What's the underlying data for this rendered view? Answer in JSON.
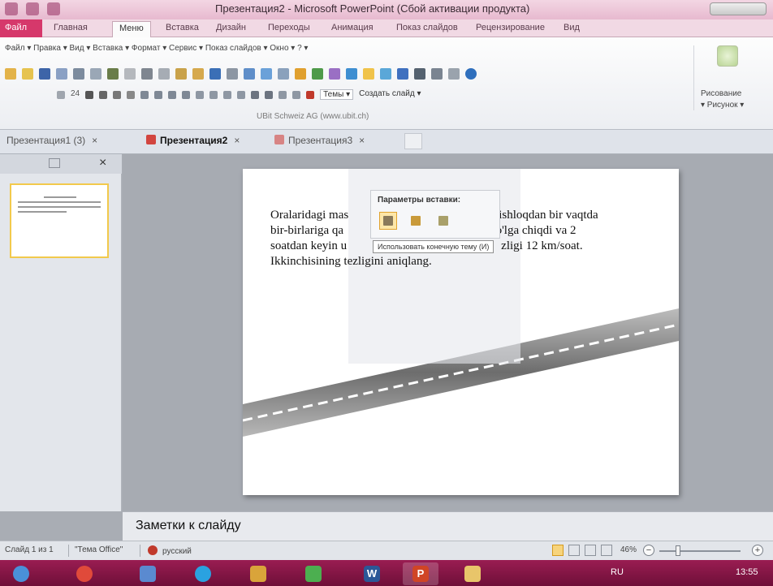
{
  "window": {
    "title": "Презентация2 - Microsoft PowerPoint (Сбой активации продукта)"
  },
  "ribbon_tabs": [
    "Файл",
    "Главная",
    "Меню",
    "Вставка",
    "Дизайн",
    "Переходы",
    "Анимация",
    "Показ слайдов",
    "Рецензирование",
    "Вид"
  ],
  "ribbon": {
    "menu_row": "Файл ▾ Правка ▾ Вид ▾ Вставка ▾ Формат ▾ Сервис ▾ Показ слайдов ▾ Окно ▾ ? ▾",
    "font_size": "24",
    "themes_label": "Темы ▾",
    "create_slide_label": "Создать слайд ▾",
    "credit": "UBit Schweiz AG   (www.ubit.ch)",
    "drawing_label": "Рисование",
    "picture_label": "▾ Рисунок ▾"
  },
  "doc_tabs": [
    {
      "label": "Презентация1 (3)",
      "close": "×"
    },
    {
      "label": "Презентация2",
      "close": "×"
    },
    {
      "label": "Презентация3",
      "close": "×"
    }
  ],
  "slide": {
    "text": "Oralaridagi masofa ... km bo'lgan ikki qishloqdan bir vaqtda bir-birlariga qarab ikki velosipedchi yo'lga chiqdi va 2 soatdan keyin uchrashdi. Birinchisining tezligi 12 km/soat. Ikkinchisining tezligini aniqlang.",
    "text_visible_lines": [
      "Oralaridagi mas",
      "ishloqdan bir vaqtda",
      "bir-birlariga qa",
      "yo'lga chiqdi va 2",
      "soatdan keyin u",
      "zligi 12 km/soat.",
      "Ikkinchisining tezligini aniqlang."
    ]
  },
  "paste_options": {
    "title": "Параметры вставки:",
    "tooltip": "Использовать конечную тему (И)"
  },
  "notes": {
    "placeholder": "Заметки к слайду"
  },
  "status": {
    "slide_info": "Слайд 1 из 1",
    "theme": "\"Тема Office\"",
    "language": "русский",
    "zoom": "46%"
  },
  "taskbar": {
    "lang": "RU",
    "time": "13:55"
  },
  "colors": {
    "accent": "#d6386b",
    "taskbar": "#8a1748",
    "selection": "#f2c94c"
  }
}
